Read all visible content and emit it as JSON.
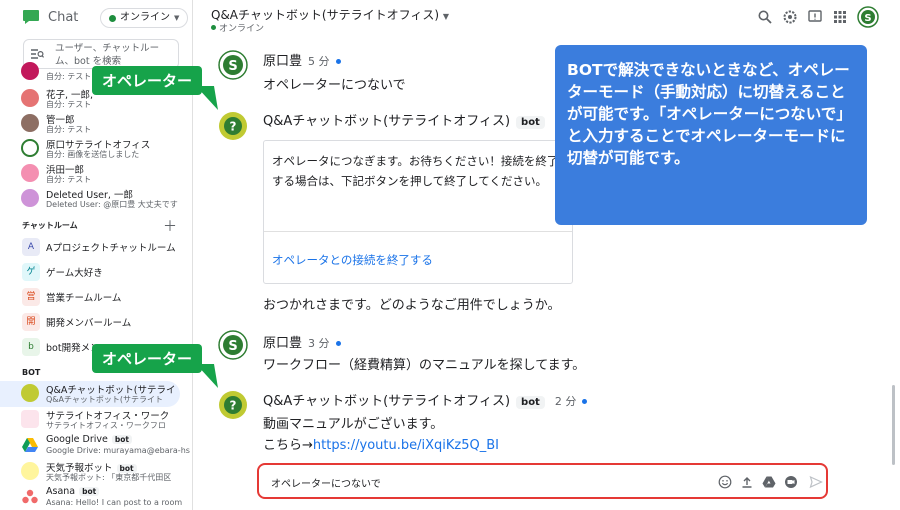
{
  "app": {
    "name": "Chat",
    "status": "オンライン"
  },
  "search": {
    "placeholder_line1": "ユーザー、チャットルー",
    "placeholder_line2": "ム、bot を検索"
  },
  "direct_messages": [
    {
      "name": "自分: テスト",
      "sub": ""
    },
    {
      "name": "花子, 一郎, 一",
      "sub": "自分: テスト"
    },
    {
      "name": "管一郎",
      "sub": "自分: テスト"
    },
    {
      "name": "原口サテライトオフィス",
      "sub": "自分: 画像を送信しました"
    },
    {
      "name": "浜田一郎",
      "sub": "自分: テスト"
    },
    {
      "name": "Deleted User, 一郎",
      "sub": "Deleted User: @原口豊 大丈夫です"
    }
  ],
  "rooms_section": {
    "label": "チャットルーム",
    "items": [
      {
        "name": "Aプロジェクトチャットルーム",
        "icon": "A"
      },
      {
        "name": "ゲーム大好き",
        "icon": "ゲ"
      },
      {
        "name": "営業チームルーム",
        "icon": "営"
      },
      {
        "name": "開発メンバールーム",
        "icon": "開"
      },
      {
        "name": "bot開発メン",
        "icon": "b"
      }
    ]
  },
  "bot_section": {
    "label": "BOT",
    "items": [
      {
        "name": "Q&Aチャットボット(サテライ",
        "sub": "Q&Aチャットボット(サテライト",
        "tag": ""
      },
      {
        "name": "サテライトオフィス・ワーク",
        "sub": "サテライトオフィス・ワークフロ",
        "tag": ""
      },
      {
        "name": "Google Drive",
        "sub": "Google Drive: murayama@ebara-hs",
        "tag": "bot"
      },
      {
        "name": "天気予報ボット",
        "sub": "天気予報ボット: 「東京都千代田区",
        "tag": "bot"
      },
      {
        "name": "Asana",
        "sub": "Asana: Hello! I can post to a room",
        "tag": "bot"
      }
    ]
  },
  "callouts": {
    "operator_1": "オペレーター",
    "operator_2": "オペレーター"
  },
  "header": {
    "title": "Q&Aチャットボット(サテライトオフィス)",
    "status": "オンライン"
  },
  "messages": [
    {
      "sender": "原口豊",
      "time": "5 分",
      "text": "オペレーターにつないで"
    },
    {
      "sender": "Q&Aチャットボット(サテライトオフィス)",
      "badge": "bot",
      "card_text": "オペレータにつなぎます。お待ちください！接続を終了する場合は、下記ボタンを押して終了してください。",
      "card_link": "オペレータとの接続を終了する",
      "text": "おつかれさまです。どのようなご用件でしょうか。"
    },
    {
      "sender": "原口豊",
      "time": "3 分",
      "text": "ワークフロー（経費精算）のマニュアルを探してます。"
    },
    {
      "sender": "Q&Aチャットボット(サテライトオフィス)",
      "badge": "bot",
      "time": "2 分",
      "text": "動画マニュアルがございます。",
      "text2_prefix": "こちら→",
      "text2_link": "https://youtu.be/iXqiKz5Q_BI"
    }
  ],
  "annotation": {
    "text": "BOTで解決できないときなど、オペレーターモード（手動対応）に切替えることが可能です。「オペレーターにつないで」と入力することでオペレーターモードに切替が可能です。"
  },
  "composer": {
    "value": "オペレーターにつないで"
  },
  "colors": {
    "accent": "#1a73e8",
    "callout_green": "#16a34a",
    "annotation_blue": "#3b7ddd",
    "composer_border": "#e53935"
  }
}
